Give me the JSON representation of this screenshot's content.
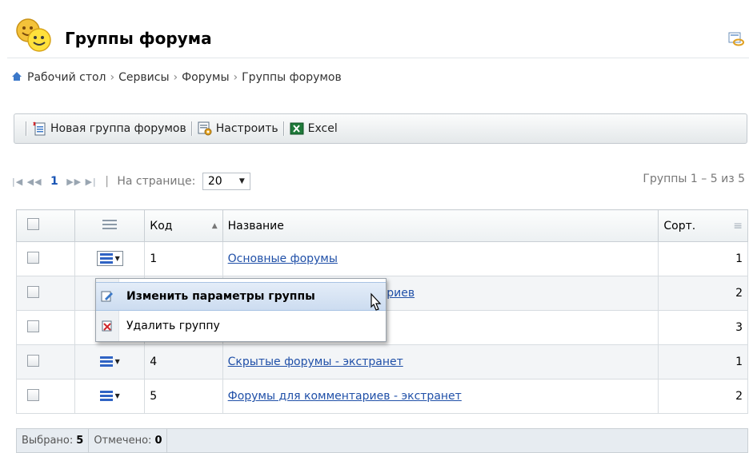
{
  "header": {
    "title": "Группы форума",
    "icon": "smiley-group-icon",
    "help_icon": "help-link-icon"
  },
  "breadcrumb": [
    "Рабочий стол",
    "Сервисы",
    "Форумы",
    "Группы форумов"
  ],
  "toolbar": {
    "new_group": "Новая группа форумов",
    "configure": "Настроить",
    "excel": "Excel"
  },
  "pager": {
    "current_page": "1",
    "per_page_label": "На странице:",
    "per_page_value": "20",
    "summary": "Группы 1 – 5 из 5"
  },
  "table": {
    "columns": {
      "code": "Код",
      "name": "Название",
      "sort": "Сорт."
    },
    "rows": [
      {
        "code": "1",
        "name": "Основные форумы",
        "sort": "1"
      },
      {
        "code": "",
        "name": "ариев",
        "sort": "2"
      },
      {
        "code": "",
        "name": "",
        "sort": "3"
      },
      {
        "code": "4",
        "name": "Скрытые форумы - экстранет",
        "sort": "1"
      },
      {
        "code": "5",
        "name": "Форумы для комментариев - экстранет",
        "sort": "2"
      }
    ]
  },
  "footer": {
    "selected_label": "Выбрано:",
    "selected_value": "5",
    "checked_label": "Отмечено:",
    "checked_value": "0"
  },
  "context_menu": {
    "items": [
      {
        "label": "Изменить параметры группы",
        "icon": "edit-icon"
      },
      {
        "label": "Удалить группу",
        "icon": "delete-icon"
      }
    ]
  },
  "colors": {
    "link": "#2050a8",
    "accent": "#1a55b5",
    "menu_highlight": "#ccdcf0"
  }
}
